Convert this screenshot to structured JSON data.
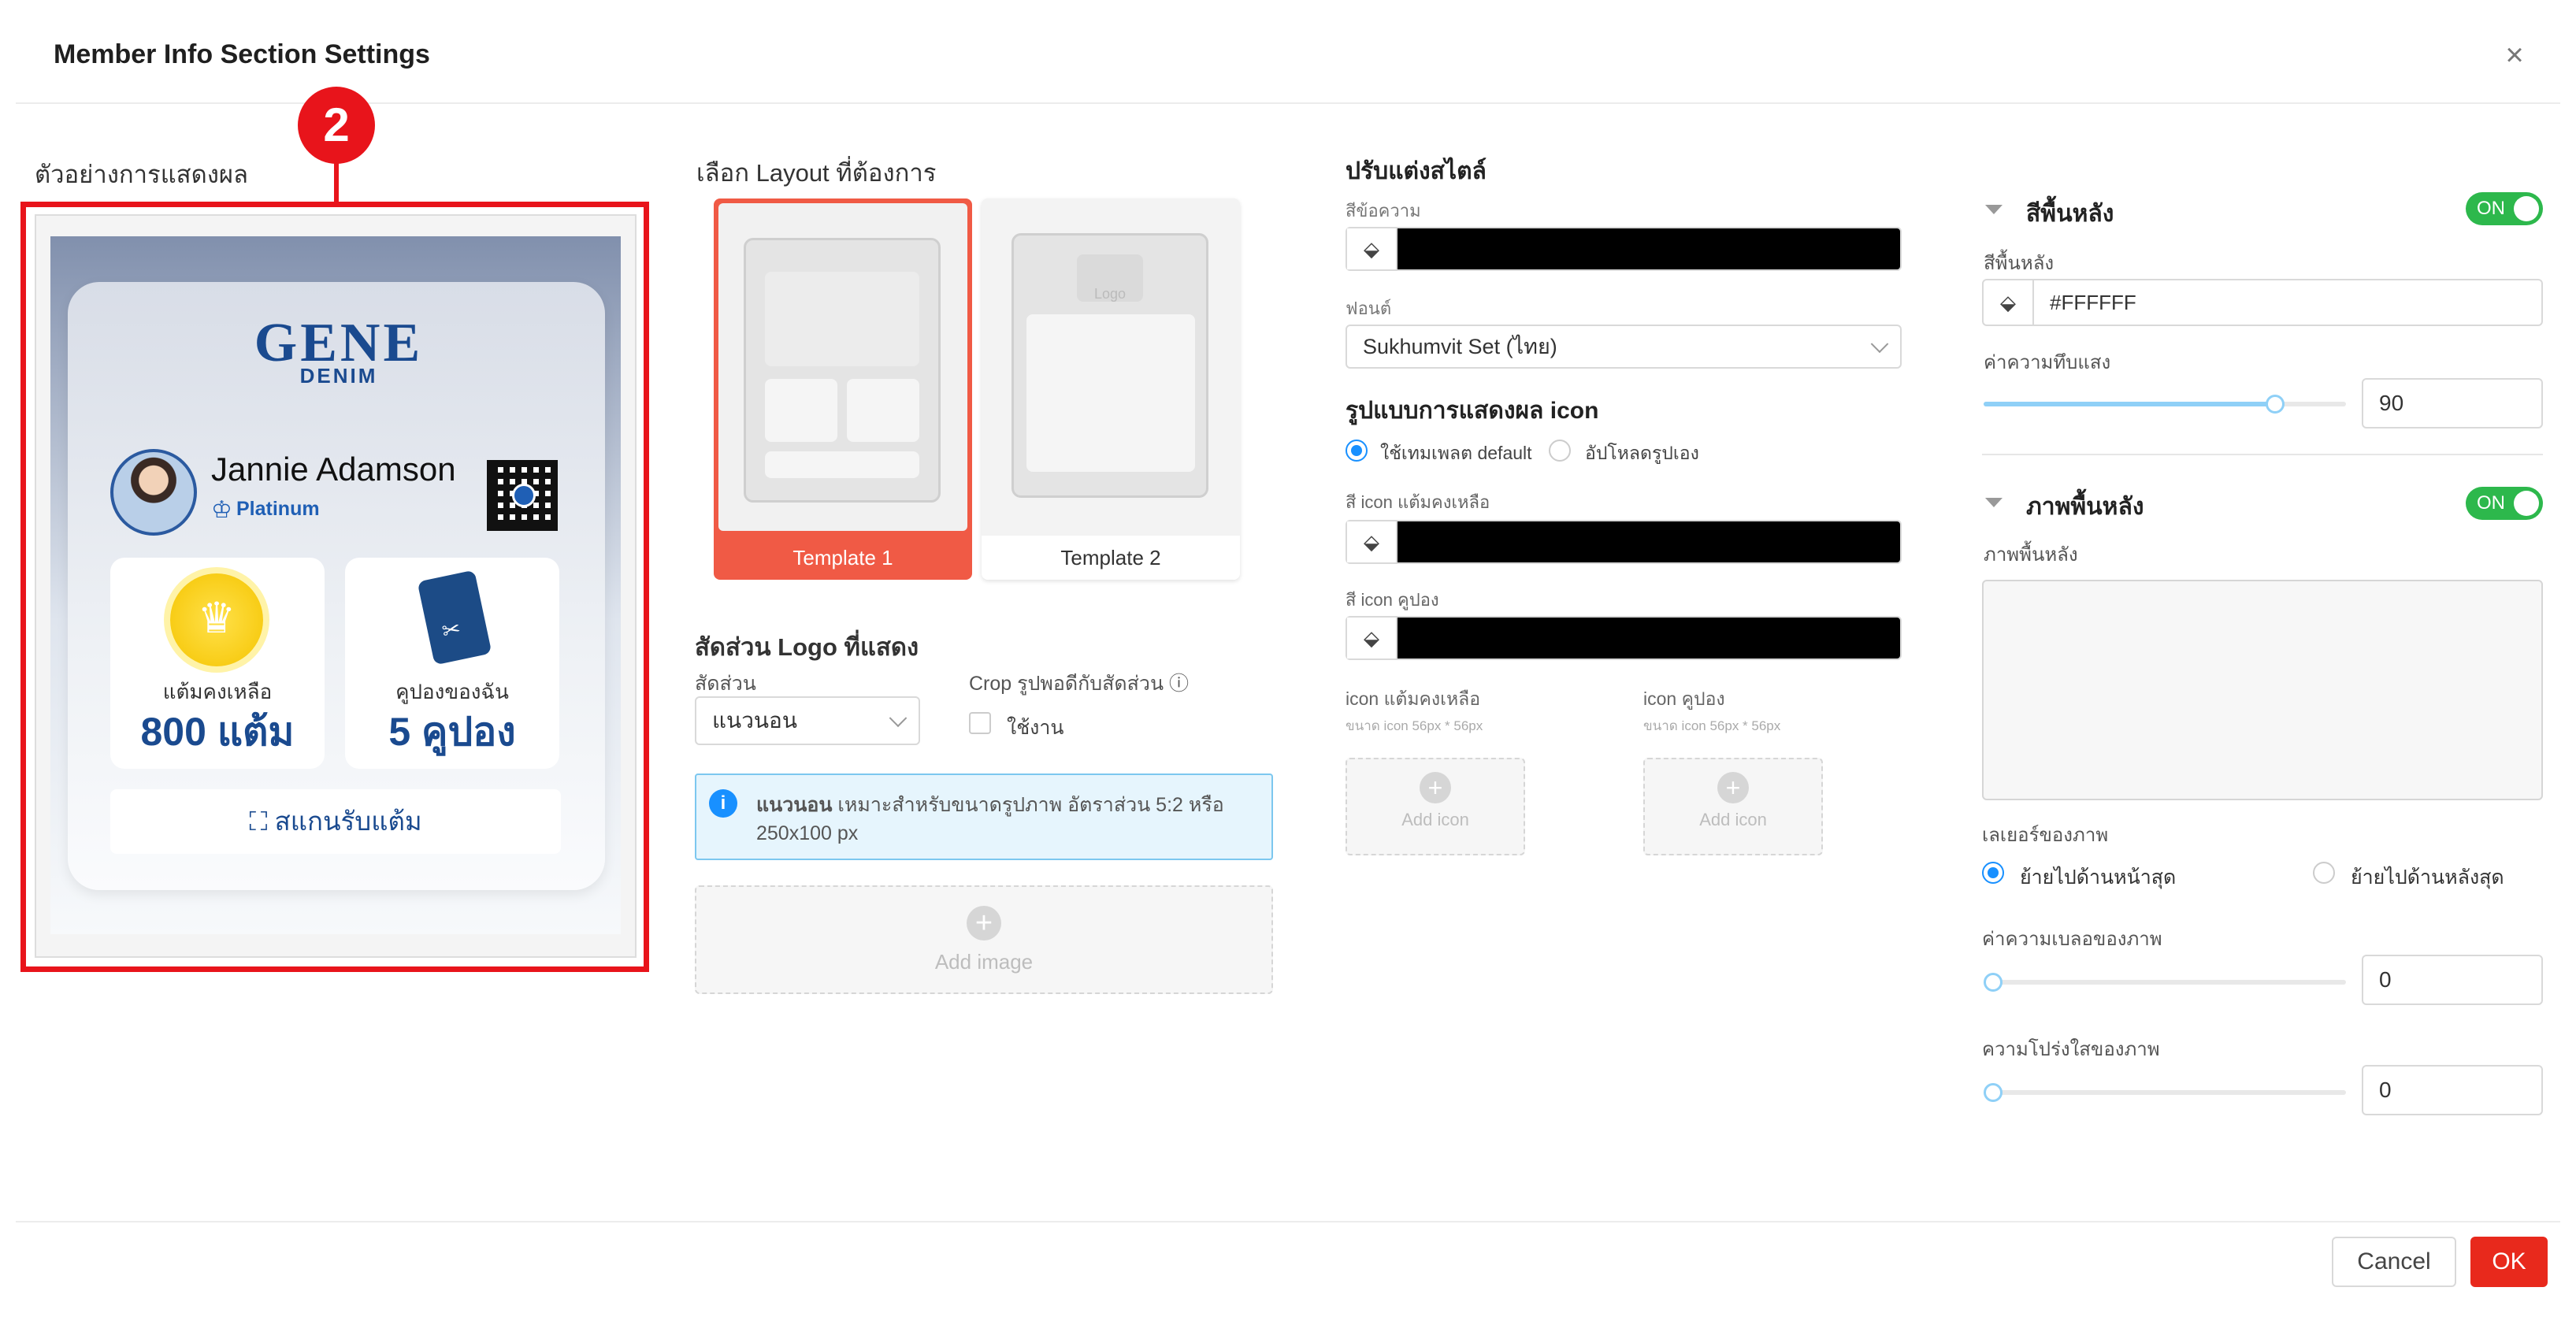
{
  "modal": {
    "title": "Member Info Section Settings",
    "close_icon": "×"
  },
  "preview": {
    "marker_number": "2",
    "section_title": "ตัวอย่างการแสดงผล",
    "brand_main": "GENE",
    "brand_sub": "DENIM",
    "member_name": "Jannie Adamson",
    "tier": "Platinum",
    "points_label": "แต้มคงเหลือ",
    "points_value": "800 แต้ม",
    "coupon_label": "คูปองของฉัน",
    "coupon_value": "5 คูปอง",
    "scan_button": "สแกนรับแต้ม"
  },
  "layout": {
    "section_title": "เลือก Layout ที่ต้องการ",
    "templates": [
      {
        "label": "Template 1",
        "selected": true
      },
      {
        "label": "Template 2",
        "selected": false
      }
    ],
    "template_art_text": "Logo",
    "logo_ratio_title": "สัดส่วน Logo ที่แสดง",
    "ratio_label": "สัดส่วน",
    "ratio_value": "แนวนอน",
    "crop_label": "Crop รูปพอดีกับสัดส่วน",
    "crop_checkbox_label": "ใช้งาน",
    "info_bold": "แนวนอน",
    "info_text": " เหมาะสำหรับขนาดรูปภาพ อัตราส่วน 5:2 หรือ 250x100 px",
    "add_image": "Add image"
  },
  "style": {
    "section_title": "ปรับแต่งสไตล์",
    "text_color_label": "สีข้อความ",
    "font_label": "ฟอนต์",
    "font_value": "Sukhumvit Set (ไทย)",
    "icon_display_title": "รูปแบบการแสดงผล icon",
    "icon_option_default": "ใช้เทมเพลต default",
    "icon_option_upload": "อัปโหลดรูปเอง",
    "points_icon_color_label": "สี icon แต้มคงเหลือ",
    "coupon_icon_color_label": "สี icon คูปอง",
    "points_icon_label": "icon แต้มคงเหลือ",
    "coupon_icon_label": "icon คูปอง",
    "icon_size_hint": "ขนาด icon 56px * 56px",
    "add_icon": "Add icon",
    "text_color": "#000000",
    "points_icon_color": "#000000",
    "coupon_icon_color": "#000000"
  },
  "background": {
    "bg_color_header": "สีพื้นหลัง",
    "bg_color_toggle": "ON",
    "bg_color_label": "สีพื้นหลัง",
    "bg_color_value": "#FFFFFF",
    "opacity_label": "ค่าความทึบแสง",
    "opacity_value": "90",
    "bg_image_header": "ภาพพื้นหลัง",
    "bg_image_toggle": "ON",
    "bg_image_label": "ภาพพื้นหลัง",
    "layer_label": "เลเยอร์ของภาพ",
    "layer_front": "ย้ายไปด้านหน้าสุด",
    "layer_back": "ย้ายไปด้านหลังสุด",
    "blur_label": "ค่าความเบลอของภาพ",
    "blur_value": "0",
    "transparency_label": "ความโปร่งใสของภาพ",
    "transparency_value": "0"
  },
  "footer": {
    "cancel": "Cancel",
    "ok": "OK"
  },
  "colors": {
    "accent_red": "#e8291c",
    "toggle_green": "#2db84c",
    "brand_blue": "#1a4a8f",
    "info_blue": "#1890ff"
  }
}
